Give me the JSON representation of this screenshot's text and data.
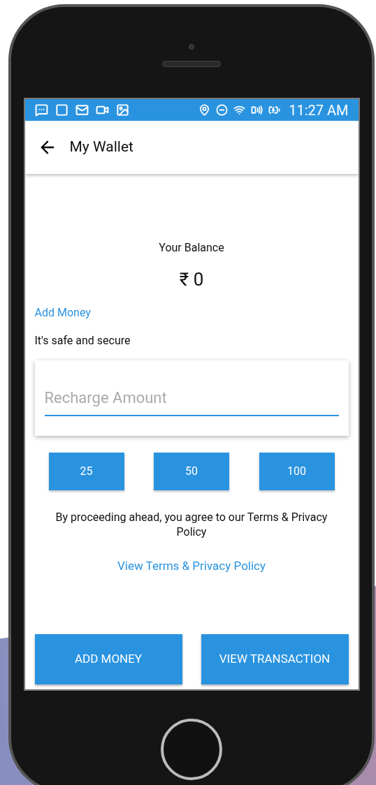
{
  "status_bar": {
    "time": "11:27 AM"
  },
  "app_bar": {
    "title": "My Wallet"
  },
  "balance": {
    "label": "Your Balance",
    "amount": "₹ 0"
  },
  "add_money_link": "Add Money",
  "safety_note": "It's safe and secure",
  "recharge_field": {
    "placeholder": "Recharge Amount"
  },
  "quick_amounts": [
    "25",
    "50",
    "100"
  ],
  "terms_text": "By proceeding ahead, you agree to our Terms & Privacy Policy",
  "terms_link": "View Terms & Privacy Policy",
  "buttons": [
    "ADD MONEY",
    "VIEW TRANSACTION"
  ]
}
